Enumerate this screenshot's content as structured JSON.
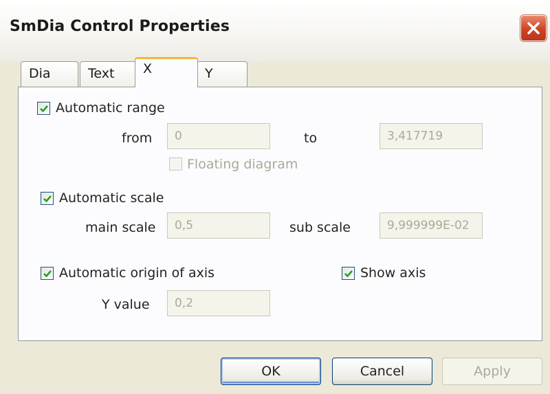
{
  "window": {
    "title": "SmDia Control Properties",
    "close_icon": "close-icon"
  },
  "tabs": [
    {
      "label": "Dia",
      "active": false
    },
    {
      "label": "Text",
      "active": false
    },
    {
      "label": "X",
      "active": true
    },
    {
      "label": "Y",
      "active": false
    }
  ],
  "range": {
    "automatic_label": "Automatic range",
    "automatic_checked": true,
    "from_label": "from",
    "from_value": "0",
    "to_label": "to",
    "to_value": "3,417719",
    "floating_label": "Floating diagram",
    "floating_checked": false,
    "floating_enabled": false
  },
  "scale": {
    "automatic_label": "Automatic scale",
    "automatic_checked": true,
    "main_label": "main scale",
    "main_value": "0,5",
    "sub_label": "sub scale",
    "sub_value": "9,999999E-02"
  },
  "origin": {
    "automatic_label": "Automatic origin of axis",
    "automatic_checked": true,
    "show_axis_label": "Show axis",
    "show_axis_checked": true,
    "y_label": "Y value",
    "y_value": "0,2"
  },
  "buttons": {
    "ok": "OK",
    "cancel": "Cancel",
    "apply": "Apply"
  },
  "colors": {
    "accent_tab": "#f3b640",
    "checkmark": "#21a121",
    "close": "#cf4322"
  }
}
